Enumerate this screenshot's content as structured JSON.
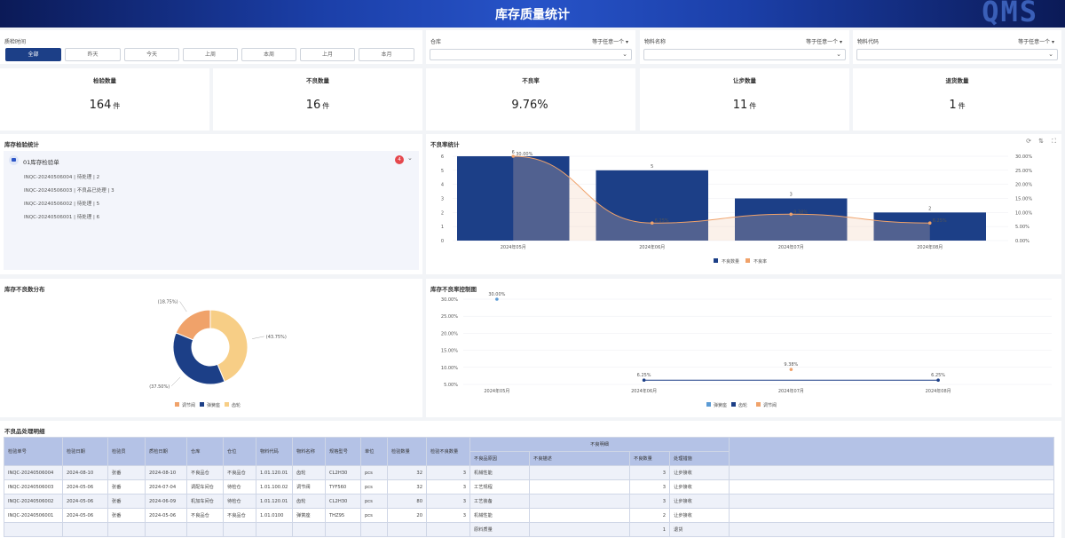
{
  "header": {
    "title": "库存质量统计",
    "logo": "QMS"
  },
  "filters": {
    "time_label": "质检时间",
    "time_buttons": [
      "全部",
      "昨天",
      "今天",
      "上周",
      "本周",
      "上月",
      "本月"
    ],
    "warehouse_label": "仓库",
    "warehouse_op": "等于任意一个",
    "material_name_label": "物料名称",
    "material_name_op": "等于任意一个",
    "material_code_label": "物料代码",
    "material_code_op": "等于任意一个"
  },
  "kpis": [
    {
      "title": "检验数量",
      "value": "164",
      "unit": "件"
    },
    {
      "title": "不良数量",
      "value": "16",
      "unit": "件"
    },
    {
      "title": "不良率",
      "value": "9.76%",
      "unit": ""
    },
    {
      "title": "让步数量",
      "value": "11",
      "unit": "件"
    },
    {
      "title": "退货数量",
      "value": "1",
      "unit": "件"
    }
  ],
  "inspection": {
    "title": "库存检验统计",
    "group": "01库存检验单",
    "badge": "4",
    "rows": [
      {
        "id": "INQC-20240506004",
        "status": "待处理",
        "count": "2"
      },
      {
        "id": "INQC-20240506003",
        "status": "不良品已处理",
        "count": "3"
      },
      {
        "id": "INQC-20240506002",
        "status": "待处理",
        "count": "5"
      },
      {
        "id": "INQC-20240506001",
        "status": "待处理",
        "count": "6"
      }
    ]
  },
  "defect_rate_chart": {
    "title": "不良率统计",
    "chart_data": {
      "type": "bar",
      "categories": [
        "2024年05月",
        "2024年06月",
        "2024年07月",
        "2024年08月"
      ],
      "series": [
        {
          "name": "不良数量",
          "type": "bar",
          "values": [
            6,
            5,
            3,
            2
          ],
          "color": "#1c3f87"
        },
        {
          "name": "不良率",
          "type": "line",
          "values": [
            30.0,
            6.25,
            9.38,
            6.25
          ],
          "color": "#f0a26a"
        }
      ],
      "y_left": {
        "ylim": [
          0,
          6
        ],
        "ticks": [
          "0",
          "1",
          "2",
          "3",
          "4",
          "5",
          "6"
        ]
      },
      "y_right": {
        "ylim": [
          0,
          30
        ],
        "ticks": [
          "0.00%",
          "5.00%",
          "10.00%",
          "15.00%",
          "20.00%",
          "25.00%",
          "30.00%"
        ]
      },
      "data_labels_bar": [
        "6",
        "5",
        "3",
        "2"
      ],
      "data_labels_line": [
        "30.00%",
        "6.25%",
        "9.38%",
        "6.25%"
      ],
      "legend": "bottom"
    }
  },
  "donut_chart": {
    "title": "库存不良数分布",
    "chart_data": {
      "type": "pie",
      "slices": [
        {
          "name": "调节阀",
          "value": 18.75,
          "label": "(18.75%)",
          "color": "#f0a26a"
        },
        {
          "name": "弹簧座",
          "value": 37.5,
          "label": "(37.50%)",
          "color": "#1c3f87"
        },
        {
          "name": "齿轮",
          "value": 43.75,
          "label": "(43.75%)",
          "color": "#f7ce86"
        }
      ],
      "legend": "bottom"
    }
  },
  "control_chart": {
    "title": "库存不良率控制图",
    "chart_data": {
      "type": "line",
      "categories": [
        "2024年05月",
        "2024年06月",
        "2024年07月",
        "2024年08月"
      ],
      "series": [
        {
          "name": "弹簧座",
          "values": [
            30.0,
            null,
            null,
            null
          ],
          "color": "#5b9bd5"
        },
        {
          "name": "齿轮",
          "values": [
            null,
            6.25,
            null,
            6.25
          ],
          "color": "#1c3f87"
        },
        {
          "name": "调节阀",
          "values": [
            null,
            null,
            9.38,
            null
          ],
          "color": "#f0a26a"
        }
      ],
      "data_labels": [
        "30.00%",
        "6.25%",
        "9.38%",
        "6.25%"
      ],
      "ylim": [
        5,
        30
      ],
      "y_ticks": [
        "30.00%",
        "25.00%",
        "20.00%",
        "15.00%",
        "10.00%",
        "5.00%"
      ],
      "legend": "bottom"
    }
  },
  "table": {
    "title": "不良品处理明细",
    "group_header": "不良明细",
    "headers": [
      "检验单号",
      "检验日期",
      "检验员",
      "质检日期",
      "仓库",
      "仓位",
      "物料代码",
      "物料名称",
      "规格型号",
      "单位",
      "检验数量",
      "检验不良数量"
    ],
    "sub_headers": [
      "不良品原因",
      "不良描述",
      "不良数量",
      "处理措施"
    ],
    "rows": [
      [
        "INQC-20240506004",
        "2024-08-10",
        "张番",
        "2024-08-10",
        "不良品仓",
        "不良品仓",
        "1.01.120.01",
        "齿轮",
        "CL2H30",
        "pcs",
        "32",
        "3",
        "机械性能",
        "",
        "3",
        "让步接收"
      ],
      [
        "INQC-20240506003",
        "2024-05-06",
        "张番",
        "2024-07-04",
        "调配车间仓",
        "待检仓",
        "1.01.100.02",
        "调节阀",
        "TYF560",
        "pcs",
        "32",
        "3",
        "工艺规程",
        "",
        "3",
        "让步接收"
      ],
      [
        "INQC-20240506002",
        "2024-05-06",
        "张番",
        "2024-06-09",
        "机加车间仓",
        "待检仓",
        "1.01.120.01",
        "齿轮",
        "CL2H30",
        "pcs",
        "80",
        "3",
        "工艺装备",
        "",
        "3",
        "让步接收"
      ],
      [
        "INQC-20240506001",
        "2024-05-06",
        "张番",
        "2024-05-06",
        "不良品仓",
        "不良品仓",
        "1.01.0100",
        "弹簧座",
        "THZ95",
        "pcs",
        "20",
        "3",
        "机械性能",
        "",
        "2",
        "让步接收"
      ],
      [
        "",
        "",
        "",
        "",
        "",
        "",
        "",
        "",
        "",
        "",
        "",
        "",
        "原料质量",
        "",
        "1",
        "退货"
      ]
    ]
  }
}
